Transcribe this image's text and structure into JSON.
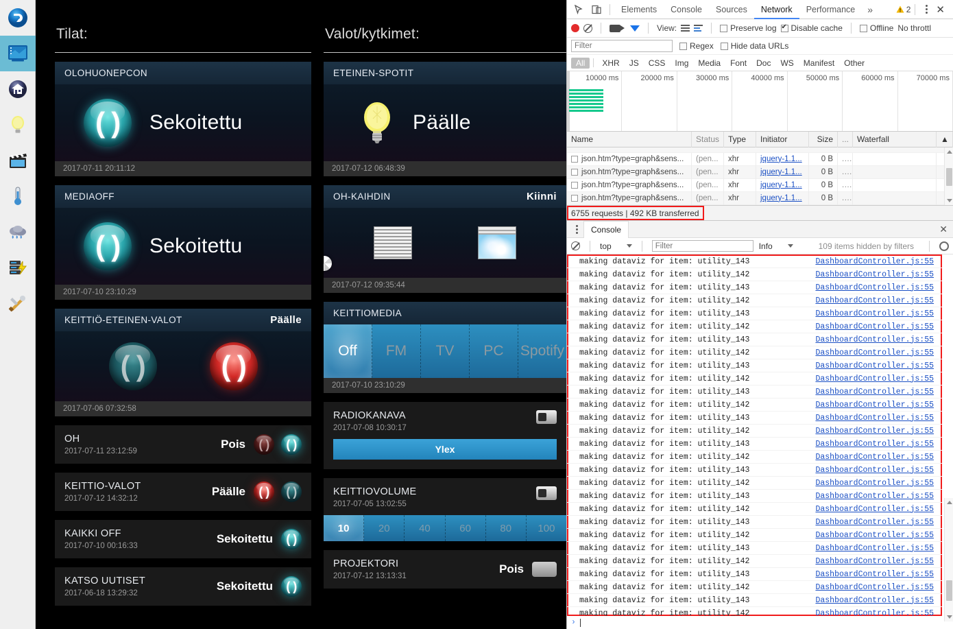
{
  "app": {
    "sidebar": {
      "items": [
        {
          "name": "logo",
          "icon": "app-logo-icon",
          "selected": false
        },
        {
          "name": "dashboard",
          "icon": "dashboard-icon",
          "selected": true
        },
        {
          "name": "home",
          "icon": "home-icon",
          "selected": false
        },
        {
          "name": "lights",
          "icon": "lightbulb-icon",
          "selected": false
        },
        {
          "name": "media",
          "icon": "movie-clapper-icon",
          "selected": false
        },
        {
          "name": "temperature",
          "icon": "thermometer-icon",
          "selected": false
        },
        {
          "name": "weather",
          "icon": "rain-cloud-icon",
          "selected": false
        },
        {
          "name": "power",
          "icon": "server-power-icon",
          "selected": false
        },
        {
          "name": "tools",
          "icon": "tools-icon",
          "selected": false
        }
      ]
    },
    "columns": {
      "left": {
        "title": "Tilat:",
        "cards": [
          {
            "kind": "big",
            "name": "OLOHUONEPCON",
            "state": "",
            "value": "Sekoitettu",
            "icon": "toggle-orb-teal-icon",
            "timestamp": "2017-07-11 20:11:12"
          },
          {
            "kind": "big",
            "name": "MEDIAOFF",
            "state": "",
            "value": "Sekoitettu",
            "icon": "toggle-orb-teal-icon",
            "timestamp": "2017-07-10 23:10:29"
          },
          {
            "kind": "big-dual",
            "name": "KEITTIÖ-ETEINEN-VALOT",
            "state": "Päälle",
            "value": "",
            "timestamp": "2017-07-06 07:32:58",
            "orbs": [
              "teal-dim",
              "red"
            ]
          },
          {
            "kind": "row",
            "name": "OH",
            "timestamp": "2017-07-11 23:12:59",
            "state": "Pois",
            "orbs": [
              "red-dim",
              "teal"
            ]
          },
          {
            "kind": "row",
            "name": "KEITTIO-VALOT",
            "timestamp": "2017-07-12 14:32:12",
            "state": "Päälle",
            "orbs": [
              "red",
              "teal-dim"
            ]
          },
          {
            "kind": "row",
            "name": "KAIKKI OFF",
            "timestamp": "2017-07-10 00:16:33",
            "state": "Sekoitettu",
            "orbs": [
              "teal"
            ]
          },
          {
            "kind": "row",
            "name": "KATSO UUTISET",
            "timestamp": "2017-06-18 13:29:32",
            "state": "Sekoitettu",
            "orbs": [
              "teal"
            ]
          }
        ]
      },
      "right": {
        "title": "Valot/kytkimet:",
        "cards": [
          {
            "kind": "bulb",
            "name": "ETEINEN-SPOTIT",
            "state": "",
            "value": "Päälle",
            "icon": "lightbulb-on-icon",
            "timestamp": "2017-07-12 06:48:39"
          },
          {
            "kind": "blinds",
            "name": "OH-KAIHDIN",
            "state": "Kiinni",
            "timestamp": "2017-07-12 09:35:44",
            "icons": [
              "blinds-closed-icon",
              "blinds-open-icon"
            ],
            "spinner": "loading-spinner-icon"
          },
          {
            "kind": "segment",
            "name": "KEITTIOMEDIA",
            "timestamp": "2017-07-10 23:10:29",
            "options": [
              "Off",
              "FM",
              "TV",
              "PC",
              "Spotify"
            ],
            "selected": "Off"
          },
          {
            "kind": "channel",
            "name": "RADIOKANAVA",
            "timestamp": "2017-07-08 10:30:17",
            "icon": "speaker-icon",
            "button_label": "Ylex"
          },
          {
            "kind": "volume",
            "name": "KEITTIOVOLUME",
            "timestamp": "2017-07-05 13:02:55",
            "icon": "speaker-icon",
            "options": [
              "10",
              "20",
              "40",
              "60",
              "80",
              "100"
            ],
            "selected": "10"
          },
          {
            "kind": "toggle",
            "name": "PROJEKTORI",
            "timestamp": "2017-07-12 13:13:31",
            "state": "Pois",
            "icon": "toggle-switch-icon"
          }
        ]
      }
    }
  },
  "devtools": {
    "tabs": [
      {
        "label": "Elements",
        "active": false
      },
      {
        "label": "Console",
        "active": false
      },
      {
        "label": "Sources",
        "active": false
      },
      {
        "label": "Network",
        "active": true
      },
      {
        "label": "Performance",
        "active": false
      }
    ],
    "more_label": "»",
    "warning_count": "2",
    "icons": {
      "inspect": "inspect-element-icon",
      "device": "device-toolbar-icon",
      "warning": "warning-triangle-icon",
      "menu": "kebab-menu-icon",
      "close": "close-icon"
    },
    "network_toolbar": {
      "record_label": "record-button",
      "clear_label": "clear-button",
      "capture_screenshots_label": "capture-screenshots-button",
      "filter_toggle_label": "filter-button",
      "view_label": "View:",
      "checkboxes": [
        {
          "label": "Preserve log",
          "checked": false
        },
        {
          "label": "Disable cache",
          "checked": true
        },
        {
          "label": "Offline",
          "checked": false
        }
      ],
      "throttle_label": "No throttl"
    },
    "filter_bar": {
      "placeholder": "Filter",
      "value": "",
      "regex_label": "Regex",
      "regex_checked": false,
      "hide_data_urls_label": "Hide data URLs",
      "hide_data_urls_checked": false
    },
    "type_filters": [
      {
        "label": "All",
        "active": true
      },
      {
        "label": "XHR",
        "active": false
      },
      {
        "label": "JS",
        "active": false
      },
      {
        "label": "CSS",
        "active": false
      },
      {
        "label": "Img",
        "active": false
      },
      {
        "label": "Media",
        "active": false
      },
      {
        "label": "Font",
        "active": false
      },
      {
        "label": "Doc",
        "active": false
      },
      {
        "label": "WS",
        "active": false
      },
      {
        "label": "Manifest",
        "active": false
      },
      {
        "label": "Other",
        "active": false
      }
    ],
    "overview": {
      "ticks": [
        "10000 ms",
        "20000 ms",
        "30000 ms",
        "40000 ms",
        "50000 ms",
        "60000 ms",
        "70000 ms"
      ],
      "bar_color": "#16c98d",
      "bar_count": 7
    },
    "network_table": {
      "headers": [
        "Name",
        "Status",
        "Type",
        "Initiator",
        "Size",
        "...",
        "Waterfall"
      ],
      "sort_indicator": "▲",
      "rows": [
        {
          "name": "json.htm?type=graph&sens...",
          "status": "(pen...",
          "type": "xhr",
          "initiator": "jquery-1.1...",
          "size": "0 B",
          "dots": "..."
        },
        {
          "name": "json.htm?type=graph&sens...",
          "status": "(pen...",
          "type": "xhr",
          "initiator": "jquery-1.1...",
          "size": "0 B",
          "dots": "..."
        },
        {
          "name": "json.htm?type=graph&sens...",
          "status": "(pen...",
          "type": "xhr",
          "initiator": "jquery-1.1...",
          "size": "0 B",
          "dots": "..."
        },
        {
          "name": "json.htm?type=graph&sens...",
          "status": "(pen...",
          "type": "xhr",
          "initiator": "jquery-1.1...",
          "size": "0 B",
          "dots": "..."
        }
      ],
      "summary": "6755 requests  |  492 KB transferred",
      "summary_highlight_color": "#f11b1b"
    },
    "drawer": {
      "tab_label": "Console",
      "context": "top",
      "filter_placeholder": "Filter",
      "filter_value": "",
      "level": "Info",
      "hidden_items": "109 items hidden by filters",
      "highlight_color": "#f11b1b",
      "log_source": "DashboardController.js:55",
      "logs": [
        "making dataviz for item: utility_143",
        "making dataviz for item: utility_142",
        "making dataviz for item: utility_143",
        "making dataviz for item: utility_142",
        "making dataviz for item: utility_143",
        "making dataviz for item: utility_142",
        "making dataviz for item: utility_143",
        "making dataviz for item: utility_142",
        "making dataviz for item: utility_143",
        "making dataviz for item: utility_142",
        "making dataviz for item: utility_143",
        "making dataviz for item: utility_142",
        "making dataviz for item: utility_143",
        "making dataviz for item: utility_142",
        "making dataviz for item: utility_143",
        "making dataviz for item: utility_142",
        "making dataviz for item: utility_143",
        "making dataviz for item: utility_142",
        "making dataviz for item: utility_143",
        "making dataviz for item: utility_142",
        "making dataviz for item: utility_143",
        "making dataviz for item: utility_142",
        "making dataviz for item: utility_143",
        "making dataviz for item: utility_142",
        "making dataviz for item: utility_143",
        "making dataviz for item: utility_142",
        "making dataviz for item: utility_143",
        "making dataviz for item: utility_142"
      ],
      "prompt_symbol": "›"
    }
  }
}
